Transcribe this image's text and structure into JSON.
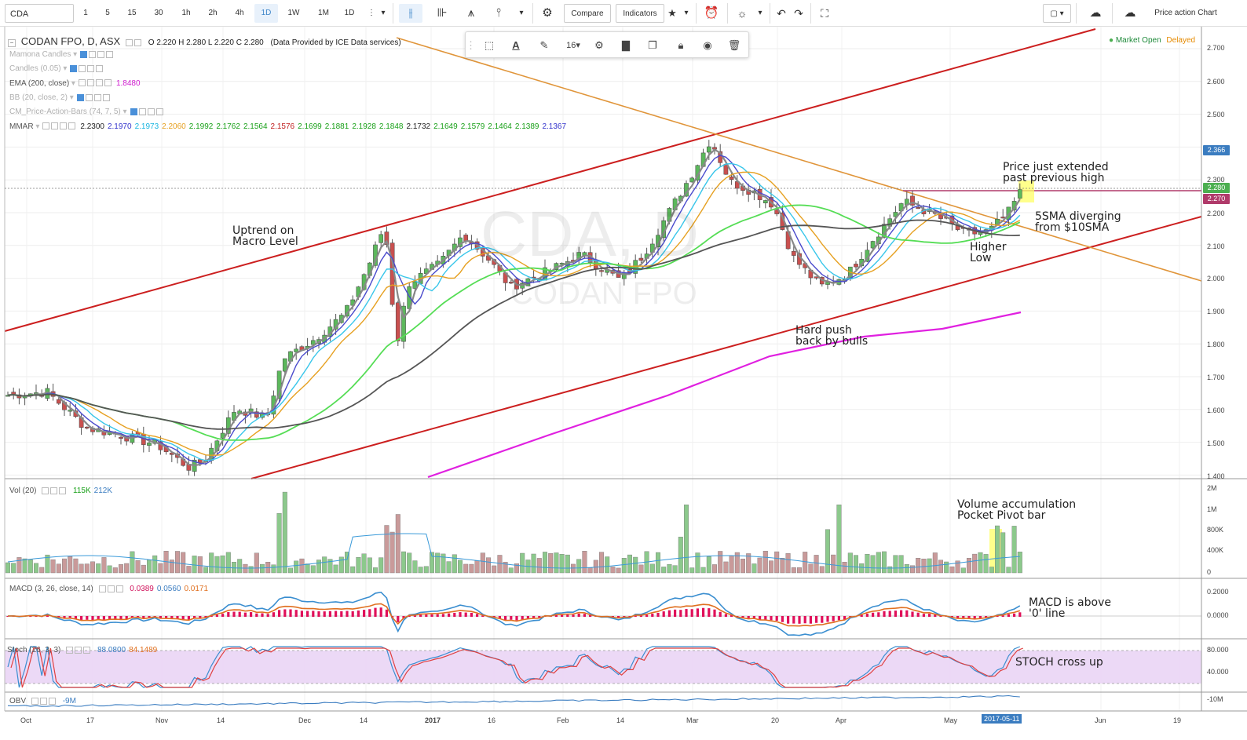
{
  "toolbar": {
    "symbol": "CDA",
    "intervals": [
      "1",
      "5",
      "15",
      "30",
      "1h",
      "2h",
      "4h",
      "1D",
      "1W",
      "1M",
      "1D"
    ],
    "active_interval_index": 7,
    "compare_label": "Compare",
    "indicators_label": "Indicators",
    "layout_name": "Price action Chart"
  },
  "legend": {
    "title": "CODAN FPO, D, ASX",
    "ohlc": "O 2.220  H 2.280  L 2.220  C 2.280",
    "provider": "(Data Provided by ICE Data services)",
    "market_status": "Market Open",
    "delayed": "Delayed",
    "indicators": [
      {
        "name": "Mamona Candles",
        "faded": true,
        "values": []
      },
      {
        "name": "Candles (0.05)",
        "faded": true,
        "values": []
      },
      {
        "name": "EMA (200, close)",
        "faded": false,
        "values": [
          {
            "v": "1.8480",
            "color": "#d020d0"
          }
        ]
      },
      {
        "name": "BB (20, close, 2)",
        "faded": true,
        "values": []
      },
      {
        "name": "CM_Price-Action-Bars (74, 7, 5)",
        "faded": true,
        "values": []
      },
      {
        "name": "MMAR",
        "faded": false,
        "values": [
          {
            "v": "2.2300",
            "color": "#222222"
          },
          {
            "v": "2.1970",
            "color": "#3333cc"
          },
          {
            "v": "2.1973",
            "color": "#19b5e0"
          },
          {
            "v": "2.2060",
            "color": "#e6a020"
          },
          {
            "v": "2.1992",
            "color": "#18a018"
          },
          {
            "v": "2.1762",
            "color": "#18a018"
          },
          {
            "v": "2.1564",
            "color": "#18a018"
          },
          {
            "v": "2.1576",
            "color": "#c02020"
          },
          {
            "v": "2.1699",
            "color": "#18a018"
          },
          {
            "v": "2.1881",
            "color": "#18a018"
          },
          {
            "v": "2.1928",
            "color": "#18a018"
          },
          {
            "v": "2.1848",
            "color": "#18a018"
          },
          {
            "v": "2.1732",
            "color": "#222222"
          },
          {
            "v": "2.1649",
            "color": "#18a018"
          },
          {
            "v": "2.1579",
            "color": "#18a018"
          },
          {
            "v": "2.1464",
            "color": "#18a018"
          },
          {
            "v": "2.1389",
            "color": "#18a018"
          },
          {
            "v": "2.1367",
            "color": "#3333cc"
          }
        ]
      }
    ]
  },
  "watermark": {
    "symbol": "CDA, D",
    "name": "CODAN FPO"
  },
  "draw_toolbar": {
    "font_size": "16"
  },
  "price_axis": {
    "ticks": [
      "2.700",
      "2.600",
      "2.500",
      "2.300",
      "2.200",
      "2.100",
      "2.000",
      "1.900",
      "1.800",
      "1.700",
      "1.600",
      "1.500",
      "1.400"
    ],
    "labels": [
      {
        "text": "2.366",
        "color": "#3a7cc0"
      },
      {
        "text": "2.280",
        "color": "#4caf50"
      },
      {
        "text": "2.270",
        "color": "#b03a6a"
      }
    ]
  },
  "time_axis": {
    "ticks": [
      "Oct",
      "17",
      "Nov",
      "14",
      "Dec",
      "14",
      "2017",
      "16",
      "Feb",
      "14",
      "Mar",
      "20",
      "Apr",
      "May",
      "Jun",
      "19"
    ],
    "current": "2017-05-11"
  },
  "annotations": {
    "uptrend": "Uptrend on\nMacro Level",
    "price_extended": "Price just extended\npast previous high",
    "sma_diverging": "5SMA diverging\nfrom $10SMA",
    "higher_low": "Higher\nLow",
    "hard_push": "Hard push\nback by bulls",
    "volume": "Volume accumulation\nPocket Pivot bar",
    "macd_note": "MACD is above\n'0' line",
    "stoch_note": "STOCH cross up"
  },
  "vol_pane": {
    "legend": "Vol (20)",
    "values": [
      {
        "v": "115K",
        "color": "#18a018"
      },
      {
        "v": "212K",
        "color": "#3a7cc0"
      }
    ],
    "ticks": [
      "2M",
      "1M",
      "800K",
      "400K",
      "0"
    ]
  },
  "macd_pane": {
    "legend": "MACD (3, 26, close, 14)",
    "values": [
      {
        "v": "0.0389",
        "color": "#d0105a"
      },
      {
        "v": "0.0560",
        "color": "#3a7cc0"
      },
      {
        "v": "0.0171",
        "color": "#e07020"
      }
    ],
    "ticks": [
      "0.2000",
      "0.0000"
    ]
  },
  "stoch_pane": {
    "legend": "Stoch (26, 3, 3)",
    "values": [
      {
        "v": "88.0800",
        "color": "#3a7cc0"
      },
      {
        "v": "84.1489",
        "color": "#e07020"
      }
    ],
    "ticks": [
      "80.000",
      "40.000"
    ]
  },
  "obv_pane": {
    "legend": "OBV",
    "values": [
      {
        "v": "-9M",
        "color": "#3a7cc0"
      }
    ],
    "ticks": [
      "-10M"
    ]
  },
  "colors": {
    "up": "#5cb85c",
    "down": "#c9504f",
    "trendline": "#cc1f1f",
    "resistance": "#e0953a",
    "ema200": "#e020e0",
    "stoch_band": "#ead5f5"
  }
}
